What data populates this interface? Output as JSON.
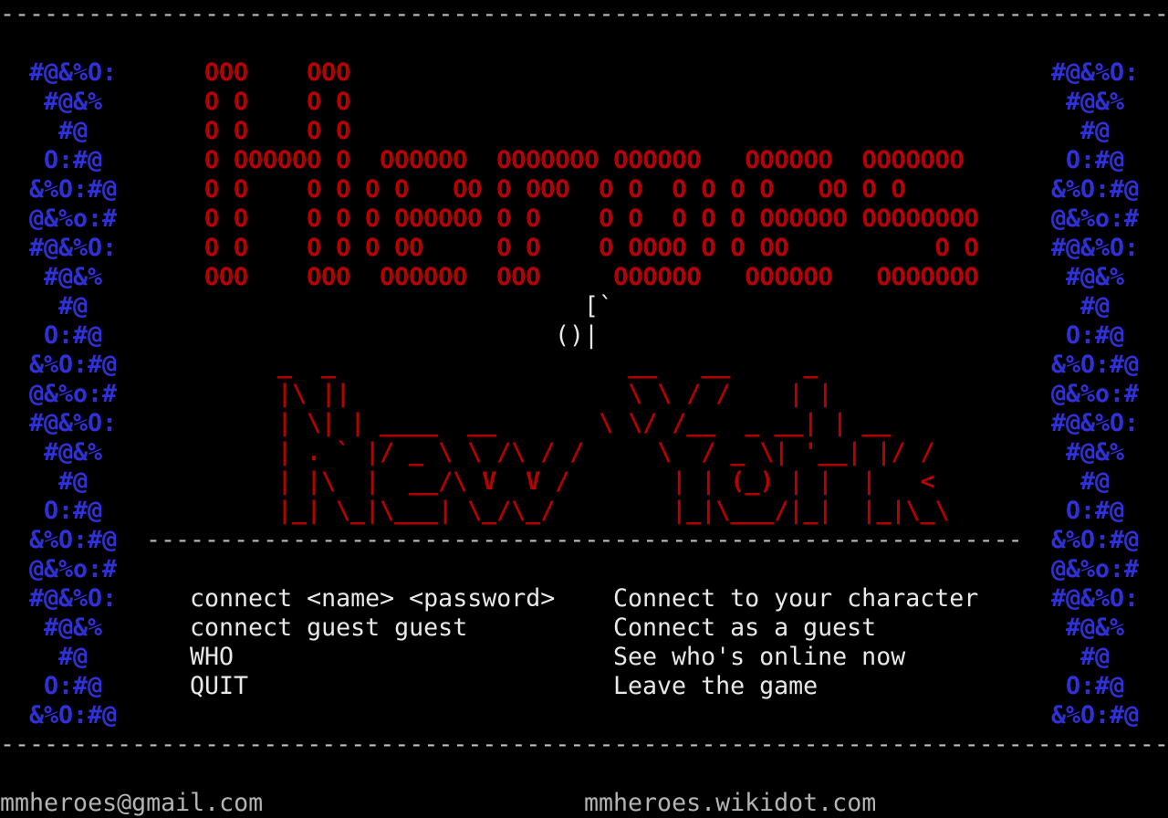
{
  "top_rule": "----------------------------------------------------------------------------------------------------------------------------",
  "side_art": {
    "left": [
      "#@&%O:",
      " #@&%",
      "  #@",
      " O:#@",
      "&%O:#@",
      "@&%o:#",
      "#@&%O:",
      " #@&%",
      "  #@",
      " O:#@",
      "&%O:#@",
      "@&%o:#",
      "#@&%O:",
      " #@&%",
      "  #@",
      " O:#@",
      "&%O:#@",
      "@&%o:#",
      "#@&%O:",
      " #@&%",
      "  #@",
      " O:#@",
      "&%O:#@"
    ],
    "right": [
      "#@&%O:",
      " #@&%",
      "  #@",
      " O:#@",
      "&%O:#@",
      "@&%o:#",
      "#@&%O:",
      " #@&%",
      "  #@",
      " O:#@",
      "&%O:#@",
      "@&%o:#",
      "#@&%O:",
      " #@&%",
      "  #@",
      " O:#@",
      "&%O:#@",
      "@&%o:#",
      "#@&%O:",
      " #@&%",
      "  #@",
      " O:#@",
      "&%O:#@"
    ]
  },
  "title_banner": [
    "OOO    OOO",
    "O O    O O",
    "O O    O O",
    "O OOOOOO O  OOOOOO  OOOOOOO OOOOOO   OOOOOO  OOOOOOO",
    "O O    O O O O   OO O OOO  O O  O O O O   OO O O",
    "O O    O O O OOOOOO O O    O O  O O O OOOOOO OOOOOOOO",
    "O O    O O O OO     O O    O OOOO O O OO          O O",
    "OOO    OOO  OOOOOO  OOO     OOOOOO   OOOOOO   OOOOOOO"
  ],
  "figure": [
    "[`",
    "()|"
  ],
  "subtitle_art": [
    "_  _                    __   __     _",
    "|\\ ||                   \\ \\ / /    | |",
    "| \\| | ____  __       \\ \\/ /__  _ __| | __",
    "| . ` |/ _ \\ \\ /\\ / /     \\  / _ \\| '__| |/ /",
    "| |\\  |  __/\\ V  V /       | | (_) | |  |   <",
    "|_| \\_|\\___| \\_/\\_/        |_|\\___/|_|  |_|\\_\\"
  ],
  "divider": "------------------------------------------------------------",
  "commands": [
    {
      "cmd": "connect <name> <password>",
      "desc": "Connect to your character"
    },
    {
      "cmd": "connect guest guest",
      "desc": "Connect as a guest"
    },
    {
      "cmd": "WHO",
      "desc": "See who's online now"
    },
    {
      "cmd": "QUIT",
      "desc": "Leave the game"
    }
  ],
  "bottom_rule": "----------------------------------------------------------------------------------------------------------------------------",
  "footer": {
    "email": "mmheroes@gmail.com",
    "site": "mmheroes.wikidot.com"
  }
}
